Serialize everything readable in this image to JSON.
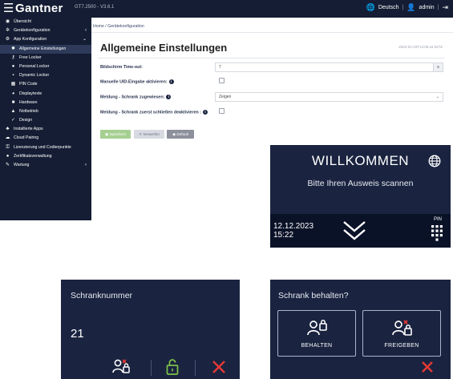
{
  "topbar": {
    "brand": "Gantner",
    "version": "GT7.2500 - V3.6.1",
    "language": "Deutsch",
    "user": "admin",
    "separator": "|"
  },
  "sidebar": {
    "items": [
      {
        "label": "Übersicht",
        "icon": "dashboard-icon"
      },
      {
        "label": "Gerätekonfiguration",
        "icon": "settings-icon",
        "chevron": "‹"
      },
      {
        "label": "App Konfiguration",
        "icon": "sliders-icon",
        "chevron": "⌄"
      },
      {
        "label": "Allgemeine Einstellungen",
        "icon": "gear-icon"
      },
      {
        "label": "Free Locker",
        "icon": "key-icon"
      },
      {
        "label": "Personal Locker",
        "icon": "person-icon"
      },
      {
        "label": "Dynamic Locker",
        "icon": "lock-icon"
      },
      {
        "label": "PIN Code",
        "icon": "keypad-icon"
      },
      {
        "label": "Displaytexte",
        "icon": "text-icon"
      },
      {
        "label": "Hardware",
        "icon": "chip-icon"
      },
      {
        "label": "Notbetrieb",
        "icon": "warning-icon"
      },
      {
        "label": "Design",
        "icon": "brush-icon"
      },
      {
        "label": "Installierte Apps",
        "icon": "apps-icon"
      },
      {
        "label": "Cloud Pairing",
        "icon": "cloud-icon"
      },
      {
        "label": "Lizenzierung und Codierpunkte",
        "icon": "license-icon"
      },
      {
        "label": "Zertifikatsverwaltung",
        "icon": "certificate-icon"
      },
      {
        "label": "Wartung",
        "icon": "wrench-icon",
        "chevron": "‹"
      }
    ]
  },
  "breadcrumb": "Home / Gerätekonfiguration",
  "page": {
    "title": "Allgemeine Einstellungen",
    "timestamp": "2024-01-03T13:08:44.027Z"
  },
  "form": {
    "timeout_label": "Bildschirm Time-out:",
    "timeout_value": "7",
    "timeout_suffix": "s",
    "uid_label": "Manuelle UID-Eingabe aktivieren:",
    "assigned_label": "Meldung - Schrank zugewiesen:",
    "assigned_value": "Zeigen",
    "close_label": "Meldung - Schrank zuerst schließen deaktivieren :"
  },
  "buttons": {
    "save": "Speichern",
    "discard": "Verwerfen",
    "default": "Default"
  },
  "welcome_screen": {
    "title": "WILLKOMMEN",
    "subtitle": "Bitte Ihren Ausweis scannen",
    "date": "12.12.2023",
    "time": "15:22",
    "pin_label": "PIN"
  },
  "locker_screen": {
    "title": "Schranknummer",
    "number": "21"
  },
  "keep_screen": {
    "title": "Schrank behalten?",
    "keep_label": "BEHALTEN",
    "release_label": "FREIGEBEN"
  },
  "colors": {
    "dark_panel": "#1a2440",
    "nav": "#141d33",
    "save": "#a6cf92",
    "cancel": "#e53935",
    "unlock": "#7ec24a"
  }
}
